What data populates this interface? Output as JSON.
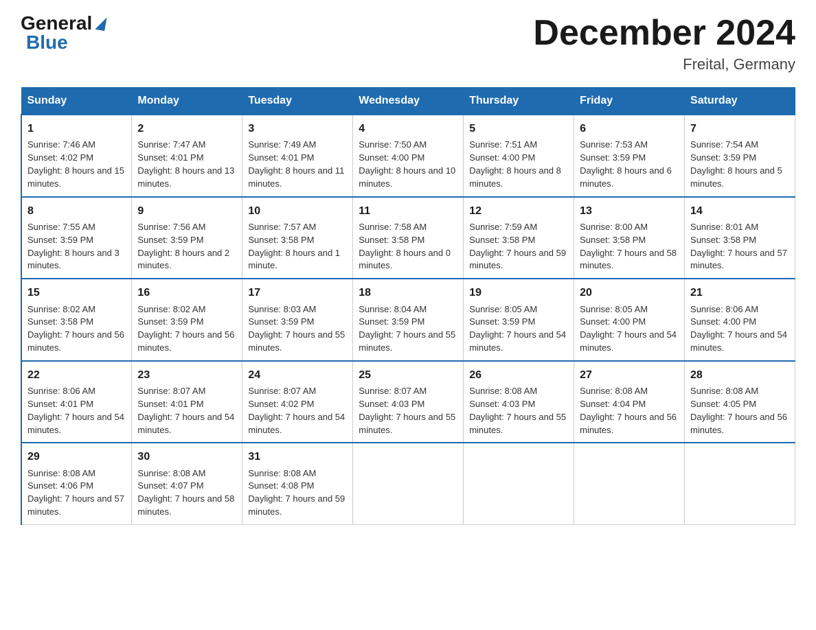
{
  "logo": {
    "general": "General",
    "blue": "Blue"
  },
  "header": {
    "month_title": "December 2024",
    "subtitle": "Freital, Germany"
  },
  "days_of_week": [
    "Sunday",
    "Monday",
    "Tuesday",
    "Wednesday",
    "Thursday",
    "Friday",
    "Saturday"
  ],
  "weeks": [
    [
      {
        "day": "1",
        "sunrise": "7:46 AM",
        "sunset": "4:02 PM",
        "daylight": "8 hours and 15 minutes."
      },
      {
        "day": "2",
        "sunrise": "7:47 AM",
        "sunset": "4:01 PM",
        "daylight": "8 hours and 13 minutes."
      },
      {
        "day": "3",
        "sunrise": "7:49 AM",
        "sunset": "4:01 PM",
        "daylight": "8 hours and 11 minutes."
      },
      {
        "day": "4",
        "sunrise": "7:50 AM",
        "sunset": "4:00 PM",
        "daylight": "8 hours and 10 minutes."
      },
      {
        "day": "5",
        "sunrise": "7:51 AM",
        "sunset": "4:00 PM",
        "daylight": "8 hours and 8 minutes."
      },
      {
        "day": "6",
        "sunrise": "7:53 AM",
        "sunset": "3:59 PM",
        "daylight": "8 hours and 6 minutes."
      },
      {
        "day": "7",
        "sunrise": "7:54 AM",
        "sunset": "3:59 PM",
        "daylight": "8 hours and 5 minutes."
      }
    ],
    [
      {
        "day": "8",
        "sunrise": "7:55 AM",
        "sunset": "3:59 PM",
        "daylight": "8 hours and 3 minutes."
      },
      {
        "day": "9",
        "sunrise": "7:56 AM",
        "sunset": "3:59 PM",
        "daylight": "8 hours and 2 minutes."
      },
      {
        "day": "10",
        "sunrise": "7:57 AM",
        "sunset": "3:58 PM",
        "daylight": "8 hours and 1 minute."
      },
      {
        "day": "11",
        "sunrise": "7:58 AM",
        "sunset": "3:58 PM",
        "daylight": "8 hours and 0 minutes."
      },
      {
        "day": "12",
        "sunrise": "7:59 AM",
        "sunset": "3:58 PM",
        "daylight": "7 hours and 59 minutes."
      },
      {
        "day": "13",
        "sunrise": "8:00 AM",
        "sunset": "3:58 PM",
        "daylight": "7 hours and 58 minutes."
      },
      {
        "day": "14",
        "sunrise": "8:01 AM",
        "sunset": "3:58 PM",
        "daylight": "7 hours and 57 minutes."
      }
    ],
    [
      {
        "day": "15",
        "sunrise": "8:02 AM",
        "sunset": "3:58 PM",
        "daylight": "7 hours and 56 minutes."
      },
      {
        "day": "16",
        "sunrise": "8:02 AM",
        "sunset": "3:59 PM",
        "daylight": "7 hours and 56 minutes."
      },
      {
        "day": "17",
        "sunrise": "8:03 AM",
        "sunset": "3:59 PM",
        "daylight": "7 hours and 55 minutes."
      },
      {
        "day": "18",
        "sunrise": "8:04 AM",
        "sunset": "3:59 PM",
        "daylight": "7 hours and 55 minutes."
      },
      {
        "day": "19",
        "sunrise": "8:05 AM",
        "sunset": "3:59 PM",
        "daylight": "7 hours and 54 minutes."
      },
      {
        "day": "20",
        "sunrise": "8:05 AM",
        "sunset": "4:00 PM",
        "daylight": "7 hours and 54 minutes."
      },
      {
        "day": "21",
        "sunrise": "8:06 AM",
        "sunset": "4:00 PM",
        "daylight": "7 hours and 54 minutes."
      }
    ],
    [
      {
        "day": "22",
        "sunrise": "8:06 AM",
        "sunset": "4:01 PM",
        "daylight": "7 hours and 54 minutes."
      },
      {
        "day": "23",
        "sunrise": "8:07 AM",
        "sunset": "4:01 PM",
        "daylight": "7 hours and 54 minutes."
      },
      {
        "day": "24",
        "sunrise": "8:07 AM",
        "sunset": "4:02 PM",
        "daylight": "7 hours and 54 minutes."
      },
      {
        "day": "25",
        "sunrise": "8:07 AM",
        "sunset": "4:03 PM",
        "daylight": "7 hours and 55 minutes."
      },
      {
        "day": "26",
        "sunrise": "8:08 AM",
        "sunset": "4:03 PM",
        "daylight": "7 hours and 55 minutes."
      },
      {
        "day": "27",
        "sunrise": "8:08 AM",
        "sunset": "4:04 PM",
        "daylight": "7 hours and 56 minutes."
      },
      {
        "day": "28",
        "sunrise": "8:08 AM",
        "sunset": "4:05 PM",
        "daylight": "7 hours and 56 minutes."
      }
    ],
    [
      {
        "day": "29",
        "sunrise": "8:08 AM",
        "sunset": "4:06 PM",
        "daylight": "7 hours and 57 minutes."
      },
      {
        "day": "30",
        "sunrise": "8:08 AM",
        "sunset": "4:07 PM",
        "daylight": "7 hours and 58 minutes."
      },
      {
        "day": "31",
        "sunrise": "8:08 AM",
        "sunset": "4:08 PM",
        "daylight": "7 hours and 59 minutes."
      },
      null,
      null,
      null,
      null
    ]
  ],
  "labels": {
    "sunrise": "Sunrise:",
    "sunset": "Sunset:",
    "daylight": "Daylight:"
  }
}
